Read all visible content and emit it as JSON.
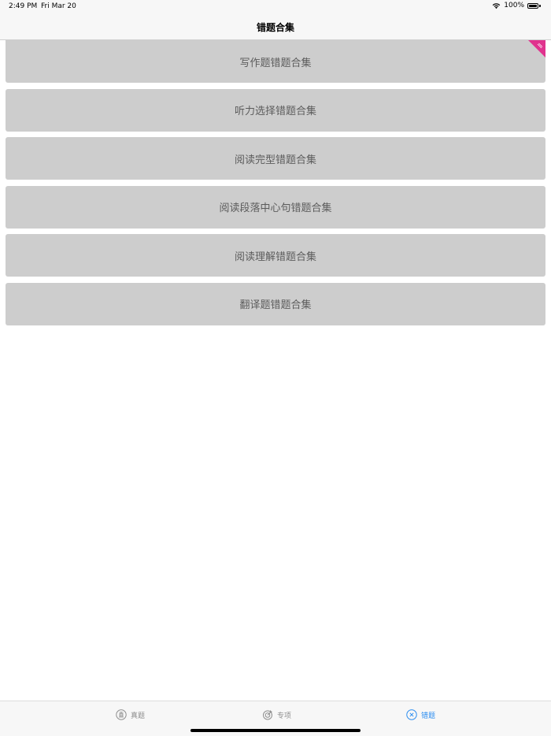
{
  "status_bar": {
    "time": "2:49 PM",
    "date": "Fri Mar 20",
    "battery": "100%"
  },
  "nav": {
    "title": "错题合集"
  },
  "categories": [
    {
      "label": "写作题错题合集"
    },
    {
      "label": "听力选择错题合集"
    },
    {
      "label": "阅读完型错题合集"
    },
    {
      "label": "阅读段落中心句错题合集"
    },
    {
      "label": "阅读理解错题合集"
    },
    {
      "label": "翻译题错题合集"
    }
  ],
  "tabs": [
    {
      "label": "真题",
      "icon": "zhen-circle-icon",
      "active": false
    },
    {
      "label": "专项",
      "icon": "target-icon",
      "active": false
    },
    {
      "label": "错题",
      "icon": "x-circle-icon",
      "active": true
    }
  ],
  "colors": {
    "active_tab": "#2d8ef0",
    "inactive_tab": "#8e8e8e",
    "button_bg": "#cdcdcd",
    "ribbon": "#e0338e"
  }
}
